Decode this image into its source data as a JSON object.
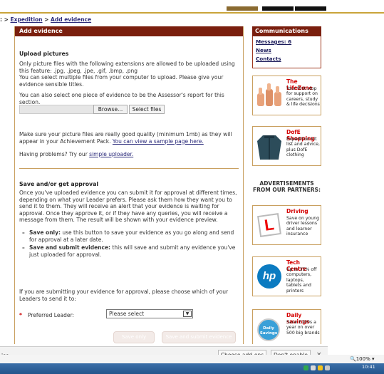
{
  "breadcrumb": {
    "prefix": ": > ",
    "expedition": "Expedition",
    "sep": " > ",
    "current": "Add evidence"
  },
  "main": {
    "header": "Add evidence",
    "upload": {
      "title": "Upload pictures",
      "intro": "Only picture files with the following extensions are allowed to be uploaded using this feature: .jpg, .jpeg, .jpe, .gif, .bmp, .png",
      "multi": "You can select multiple files from your computer to upload. Please give your evidence sensible titles.",
      "assessor": "You can also select one piece of evidence to be the Assessor's report for this section.",
      "browse_label": "Browse...",
      "select_files_label": "Select files",
      "quality_prefix": "Make sure your picture files are really good quality (minimum 1mb) as they will appear in your Achievement Pack.",
      "sample_link": "You can view a sample page here.",
      "problems_prefix": "Having problems? Try our ",
      "simple_link": "simple uploader."
    },
    "approval": {
      "title": "Save and/or get approval",
      "para1": "Once you've uploaded evidence you can submit it for approval at different times, depending on what your Leader prefers. Please ask them how they want you to send it to them. They will receive an alert that your evidence is waiting for approval. Once they approve it, or if they have any queries, you will receive a message from them. The result will be shown with your evidence preview.",
      "bullet1_bold": "Save only:",
      "bullet1_text": " use this button to save your evidence as you go along and send for approval at a later date.",
      "bullet2_bold": "Save and submit evidence:",
      "bullet2_text": " this will save and submit any evidence you've just uploaded for approval.",
      "leaders_text": "If you are submitting your evidence for approval, please choose which of your Leaders to send it to:",
      "required_mark": "*",
      "preferred_label": "Preferred Leader:",
      "select_value": "Please select",
      "save_only_label": "Save only",
      "save_submit_label": "Save and submit evidence"
    }
  },
  "sidebar": {
    "header": "Communications",
    "links": {
      "messages": "Messages: 6",
      "news": "News",
      "contacts": "Contacts"
    },
    "promos": [
      {
        "title": "The LifeZone",
        "desc": "Your first stop for support on careers, study & life decisions"
      },
      {
        "title": "DofE Shopping",
        "desc": "Expedition kit list and advice, plus DofE clothing"
      }
    ],
    "ads_heading": "ADVERTISEMENTS FROM OUR PARTNERS:",
    "ads": [
      {
        "title": "Driving",
        "desc": "Save on young driver lessons and learner insurance"
      },
      {
        "title": "Tech Centre",
        "desc": "Up to 35% off computers, laptops, tablets and printers"
      },
      {
        "title": "Daily savings",
        "desc": "Save £100s a year on over 500 big brands"
      }
    ],
    "daily_badge": "Daily Savings",
    "hp_logo": "hp",
    "l_plate": "L"
  },
  "notification": {
    "message": "ise.",
    "choose_addons": "Choose add-ons",
    "dont_enable": "Don't enable",
    "close": "×"
  },
  "status": {
    "zoom": "100%",
    "time": "10:41"
  },
  "colors": {
    "header": "#7a1f0e",
    "accent_red": "#d40000",
    "gold": "#c9a43a"
  }
}
